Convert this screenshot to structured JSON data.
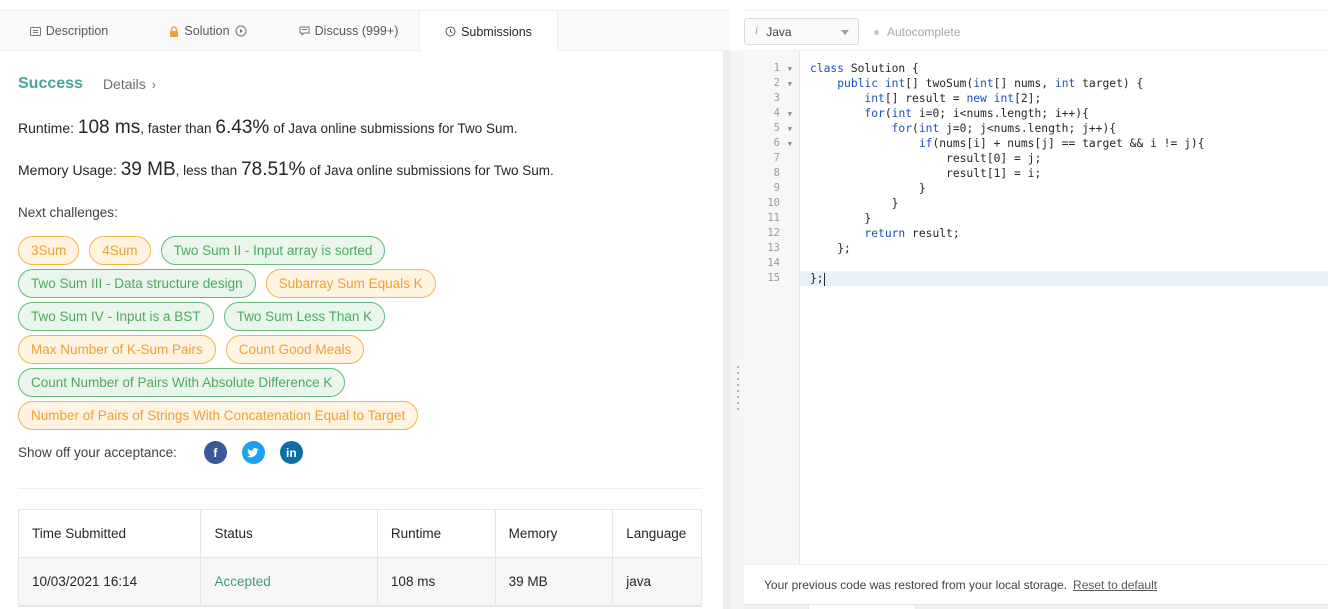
{
  "tabs": [
    {
      "label": "Description",
      "icon": "description-icon"
    },
    {
      "label": "Solution",
      "icon": "lock-icon"
    },
    {
      "label": "Discuss (999+)",
      "icon": "discuss-icon"
    },
    {
      "label": "Submissions",
      "icon": "clock-icon",
      "active": true
    }
  ],
  "result": {
    "status": "Success",
    "details_label": "Details",
    "runtime_label": "Runtime:",
    "runtime_value": "108 ms",
    "runtime_mid": ", faster than",
    "runtime_pct": "6.43%",
    "runtime_tail": "of Java online submissions for Two Sum.",
    "memory_label": "Memory Usage:",
    "memory_value": "39 MB",
    "memory_mid": ", less than",
    "memory_pct": "78.51%",
    "memory_tail": "of Java online submissions for Two Sum."
  },
  "next": {
    "label": "Next challenges:",
    "rows": [
      [
        {
          "text": "3Sum",
          "color": "orange"
        },
        {
          "text": "4Sum",
          "color": "orange"
        },
        {
          "text": "Two Sum II - Input array is sorted",
          "color": "green"
        }
      ],
      [
        {
          "text": "Two Sum III - Data structure design",
          "color": "green"
        },
        {
          "text": "Subarray Sum Equals K",
          "color": "orange"
        }
      ],
      [
        {
          "text": "Two Sum IV - Input is a BST",
          "color": "green"
        },
        {
          "text": "Two Sum Less Than K",
          "color": "green"
        }
      ],
      [
        {
          "text": "Max Number of K-Sum Pairs",
          "color": "orange"
        },
        {
          "text": "Count Good Meals",
          "color": "orange"
        }
      ],
      [
        {
          "text": "Count Number of Pairs With Absolute Difference K",
          "color": "green"
        }
      ],
      [
        {
          "text": "Number of Pairs of Strings With Concatenation Equal to Target",
          "color": "orange"
        }
      ]
    ]
  },
  "share": {
    "label": "Show off your acceptance:",
    "icons": [
      "facebook-icon",
      "twitter-icon",
      "linkedin-icon"
    ]
  },
  "submissions": {
    "headers": [
      "Time Submitted",
      "Status",
      "Runtime",
      "Memory",
      "Language"
    ],
    "rows": [
      [
        "10/03/2021 16:14",
        "Accepted",
        "108 ms",
        "39 MB",
        "java"
      ]
    ]
  },
  "editor": {
    "language": "Java",
    "autocomplete_label": "Autocomplete",
    "lines": [
      "class Solution {",
      "    public int[] twoSum(int[] nums, int target) {",
      "        int[] result = new int[2];",
      "        for(int i=0; i<nums.length; i++){",
      "            for(int j=0; j<nums.length; j++){",
      "                if(nums[i] + nums[j] == target && i != j){",
      "                    result[0] = j;",
      "                    result[1] = i;",
      "                }",
      "            }",
      "        }",
      "        return result;",
      "    };",
      "",
      "};"
    ],
    "line_numbers": [
      "1",
      "2",
      "3",
      "4",
      "5",
      "6",
      "7",
      "8",
      "9",
      "10",
      "11",
      "12",
      "13",
      "14",
      "15"
    ],
    "fold_lines": [
      1,
      2,
      4,
      5,
      6
    ],
    "active_line": 15,
    "restore_message": "Your previous code was restored from your local storage.",
    "reset_label": "Reset to default"
  },
  "colors": {
    "success": "#46a69a",
    "accepted": "#3f9e71",
    "tag_orange": "#f0a030",
    "tag_green": "#4caa5e",
    "keyword": "#1c4fbd"
  }
}
